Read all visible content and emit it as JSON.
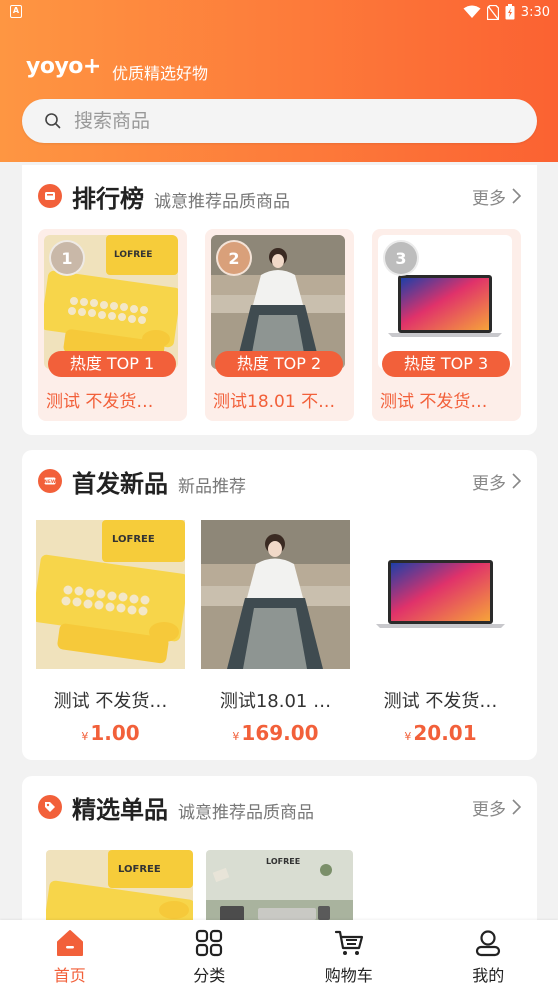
{
  "status_bar": {
    "time": "3:30"
  },
  "header": {
    "brand": "yoyo+",
    "slogan": "优质精选好物"
  },
  "search": {
    "placeholder": "搜索商品"
  },
  "ranking": {
    "title": "排行榜",
    "subtitle": "诚意推荐品质商品",
    "more_label": "更多",
    "items": [
      {
        "rank": "1",
        "tag": "热度 TOP 1",
        "name": "测试 不发货…",
        "medal_color": "#c9b8a8"
      },
      {
        "rank": "2",
        "tag": "热度 TOP 2",
        "name": "测试18.01 不…",
        "medal_color": "#d9a07a"
      },
      {
        "rank": "3",
        "tag": "热度 TOP 3",
        "name": "测试 不发货…",
        "medal_color": "#bdbdbd"
      }
    ]
  },
  "new_products": {
    "title": "首发新品",
    "subtitle": "新品推荐",
    "more_label": "更多",
    "items": [
      {
        "name": "测试 不发货…",
        "currency": "¥",
        "price": "1.00"
      },
      {
        "name": "测试18.01 …",
        "currency": "¥",
        "price": "169.00"
      },
      {
        "name": "测试 不发货…",
        "currency": "¥",
        "price": "20.01"
      }
    ]
  },
  "picks": {
    "title": "精选单品",
    "subtitle": "诚意推荐品质商品",
    "more_label": "更多"
  },
  "tabbar": {
    "items": [
      {
        "label": "首页",
        "icon": "home-icon",
        "active": true
      },
      {
        "label": "分类",
        "icon": "grid-icon",
        "active": false
      },
      {
        "label": "购物车",
        "icon": "cart-icon",
        "active": false
      },
      {
        "label": "我的",
        "icon": "user-icon",
        "active": false
      }
    ]
  },
  "colors": {
    "accent": "#f2603a",
    "header_start": "#fe9642",
    "header_end": "#fb6232"
  }
}
